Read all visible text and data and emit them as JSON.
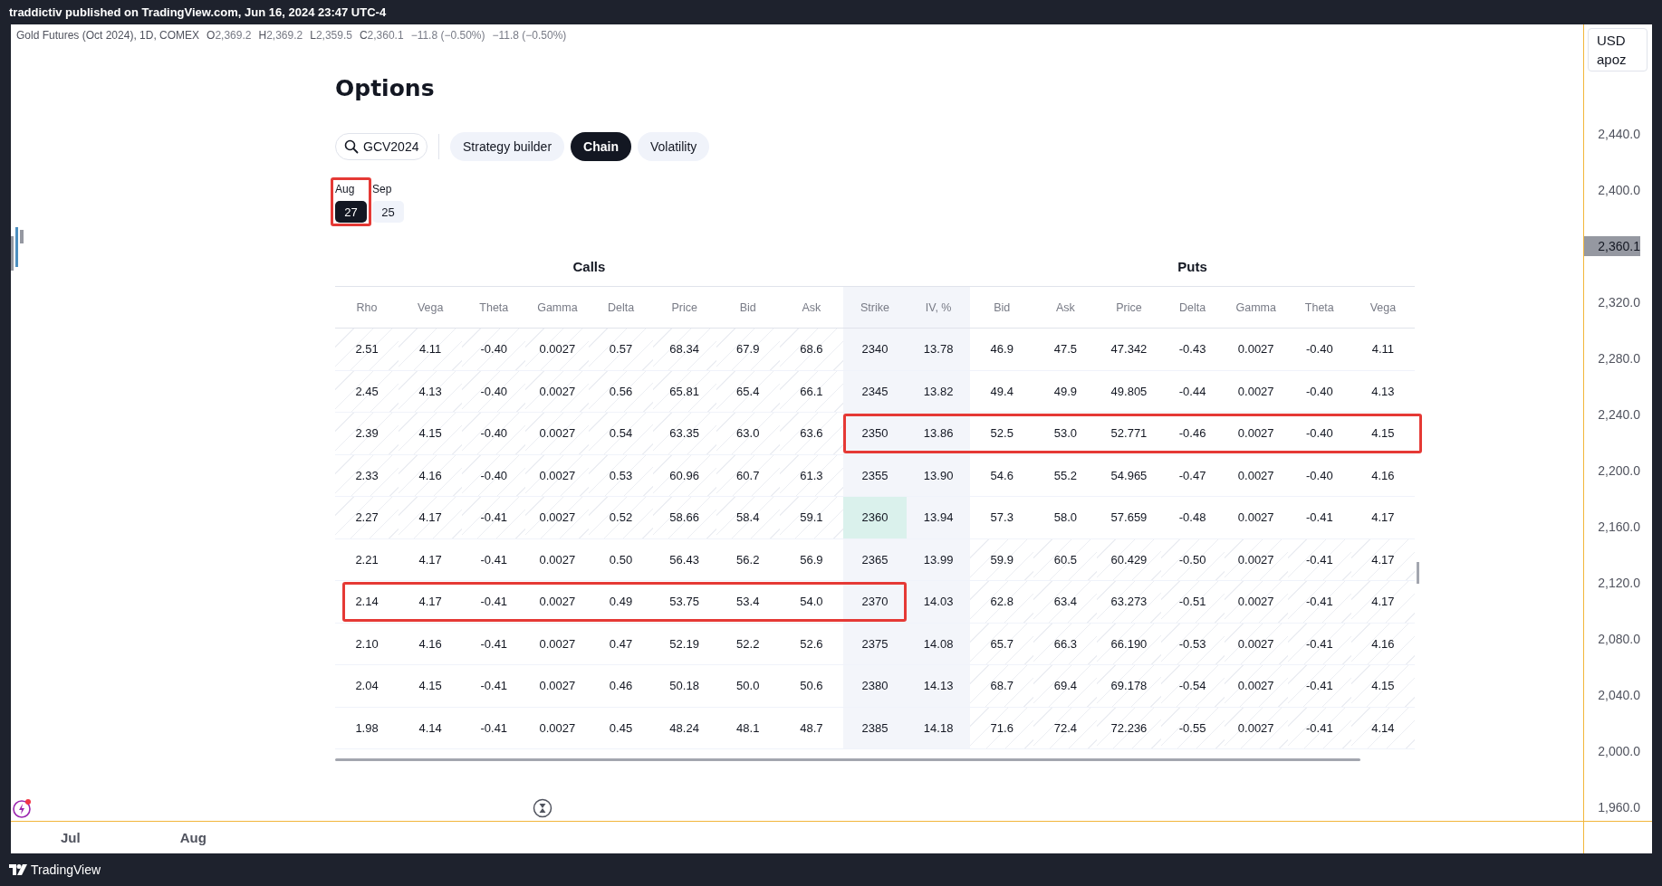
{
  "top_bar": {
    "text": "traddictiv published on TradingView.com, Jun 16, 2024 23:47 UTC-4"
  },
  "legend": {
    "symbol": "Gold Futures (Oct 2024), 1D, COMEX",
    "ohlc": [
      {
        "label": "O",
        "value": "2,369.2"
      },
      {
        "label": "H",
        "value": "2,369.2"
      },
      {
        "label": "L",
        "value": "2,359.5"
      },
      {
        "label": "C",
        "value": "2,360.1"
      }
    ],
    "changes": [
      "−11.8 (−0.50%)",
      "−11.8 (−0.50%)"
    ]
  },
  "options": {
    "title": "Options",
    "search": {
      "value": "GCV2024"
    },
    "tabs": [
      {
        "label": "Strategy builder",
        "selected": false
      },
      {
        "label": "Chain",
        "selected": true
      },
      {
        "label": "Volatility",
        "selected": false
      }
    ],
    "expirations": [
      {
        "month": "Aug",
        "day": "27",
        "selected": true,
        "outlined": true
      },
      {
        "month": "Sep",
        "day": "25",
        "selected": false,
        "outlined": false
      }
    ],
    "table": {
      "calls_title": "Calls",
      "puts_title": "Puts",
      "columns": [
        "Rho",
        "Vega",
        "Theta",
        "Gamma",
        "Delta",
        "Price",
        "Bid",
        "Ask",
        "Strike",
        "IV, %",
        "Bid",
        "Ask",
        "Price",
        "Delta",
        "Gamma",
        "Theta",
        "Vega"
      ],
      "rows": [
        {
          "cells": [
            "2.51",
            "4.11",
            "-0.40",
            "0.0027",
            "0.57",
            "68.34",
            "67.9",
            "68.6",
            "2340",
            "13.78",
            "46.9",
            "47.5",
            "47.342",
            "-0.43",
            "0.0027",
            "-0.40",
            "4.11"
          ],
          "calls_itm": true,
          "puts_itm": false,
          "atm": false,
          "outline_calls": false,
          "outline_puts": false
        },
        {
          "cells": [
            "2.45",
            "4.13",
            "-0.40",
            "0.0027",
            "0.56",
            "65.81",
            "65.4",
            "66.1",
            "2345",
            "13.82",
            "49.4",
            "49.9",
            "49.805",
            "-0.44",
            "0.0027",
            "-0.40",
            "4.13"
          ],
          "calls_itm": true,
          "puts_itm": false,
          "atm": false,
          "outline_calls": false,
          "outline_puts": false
        },
        {
          "cells": [
            "2.39",
            "4.15",
            "-0.40",
            "0.0027",
            "0.54",
            "63.35",
            "63.0",
            "63.6",
            "2350",
            "13.86",
            "52.5",
            "53.0",
            "52.771",
            "-0.46",
            "0.0027",
            "-0.40",
            "4.15"
          ],
          "calls_itm": true,
          "puts_itm": false,
          "atm": false,
          "outline_calls": false,
          "outline_puts": true
        },
        {
          "cells": [
            "2.33",
            "4.16",
            "-0.40",
            "0.0027",
            "0.53",
            "60.96",
            "60.7",
            "61.3",
            "2355",
            "13.90",
            "54.6",
            "55.2",
            "54.965",
            "-0.47",
            "0.0027",
            "-0.40",
            "4.16"
          ],
          "calls_itm": true,
          "puts_itm": false,
          "atm": false,
          "outline_calls": false,
          "outline_puts": false
        },
        {
          "cells": [
            "2.27",
            "4.17",
            "-0.41",
            "0.0027",
            "0.52",
            "58.66",
            "58.4",
            "59.1",
            "2360",
            "13.94",
            "57.3",
            "58.0",
            "57.659",
            "-0.48",
            "0.0027",
            "-0.41",
            "4.17"
          ],
          "calls_itm": true,
          "puts_itm": false,
          "atm": true,
          "outline_calls": false,
          "outline_puts": false
        },
        {
          "cells": [
            "2.21",
            "4.17",
            "-0.41",
            "0.0027",
            "0.50",
            "56.43",
            "56.2",
            "56.9",
            "2365",
            "13.99",
            "59.9",
            "60.5",
            "60.429",
            "-0.50",
            "0.0027",
            "-0.41",
            "4.17"
          ],
          "calls_itm": false,
          "puts_itm": true,
          "atm": false,
          "outline_calls": false,
          "outline_puts": false
        },
        {
          "cells": [
            "2.14",
            "4.17",
            "-0.41",
            "0.0027",
            "0.49",
            "53.75",
            "53.4",
            "54.0",
            "2370",
            "14.03",
            "62.8",
            "63.4",
            "63.273",
            "-0.51",
            "0.0027",
            "-0.41",
            "4.17"
          ],
          "calls_itm": false,
          "puts_itm": true,
          "atm": false,
          "outline_calls": true,
          "outline_puts": false
        },
        {
          "cells": [
            "2.10",
            "4.16",
            "-0.41",
            "0.0027",
            "0.47",
            "52.19",
            "52.2",
            "52.6",
            "2375",
            "14.08",
            "65.7",
            "66.3",
            "66.190",
            "-0.53",
            "0.0027",
            "-0.41",
            "4.16"
          ],
          "calls_itm": false,
          "puts_itm": true,
          "atm": false,
          "outline_calls": false,
          "outline_puts": false
        },
        {
          "cells": [
            "2.04",
            "4.15",
            "-0.41",
            "0.0027",
            "0.46",
            "50.18",
            "50.0",
            "50.6",
            "2380",
            "14.13",
            "68.7",
            "69.4",
            "69.178",
            "-0.54",
            "0.0027",
            "-0.41",
            "4.15"
          ],
          "calls_itm": false,
          "puts_itm": true,
          "atm": false,
          "outline_calls": false,
          "outline_puts": false
        },
        {
          "cells": [
            "1.98",
            "4.14",
            "-0.41",
            "0.0027",
            "0.45",
            "48.24",
            "48.1",
            "48.7",
            "2385",
            "14.18",
            "71.6",
            "72.4",
            "72.236",
            "-0.55",
            "0.0027",
            "-0.41",
            "4.14"
          ],
          "calls_itm": false,
          "puts_itm": true,
          "atm": false,
          "outline_calls": false,
          "outline_puts": false
        }
      ]
    }
  },
  "price_axis": {
    "currency": "USD",
    "unit": "apoz",
    "labels": [
      {
        "text": "2,440.0",
        "kind": "tick"
      },
      {
        "text": "2,400.0",
        "kind": "tick"
      },
      {
        "text": "2,360.1",
        "kind": "current"
      },
      {
        "text": "2,320.0",
        "kind": "tick"
      },
      {
        "text": "2,280.0",
        "kind": "tick"
      },
      {
        "text": "2,240.0",
        "kind": "tick"
      },
      {
        "text": "2,200.0",
        "kind": "tick"
      },
      {
        "text": "2,160.0",
        "kind": "tick"
      },
      {
        "text": "2,120.0",
        "kind": "tick"
      },
      {
        "text": "2,080.0",
        "kind": "tick"
      },
      {
        "text": "2,040.0",
        "kind": "tick"
      },
      {
        "text": "2,000.0",
        "kind": "tick"
      },
      {
        "text": "1,960.0",
        "kind": "tick"
      }
    ]
  },
  "time_axis": [
    "Jul",
    "Aug"
  ],
  "footer": {
    "brand": "TradingView"
  }
}
